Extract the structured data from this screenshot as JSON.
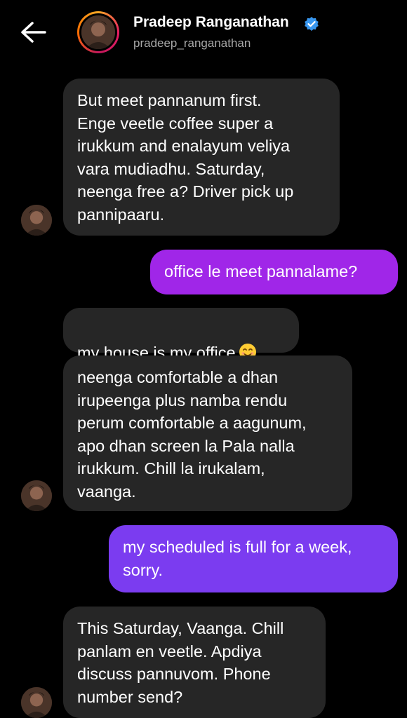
{
  "header": {
    "name": "Pradeep Ranganathan",
    "handle": "pradeep_ranganathan",
    "verified_color": "#3897f0",
    "back_icon": "back-arrow-icon"
  },
  "messages": [
    {
      "from": "them",
      "text": "But meet pannanum first.\nEnge veetle coffee super a\nirukkum and enalayum veliya\nvara mudiadhu. Saturday,\nneenga free a? Driver pick up\npannipaaru."
    },
    {
      "from": "me",
      "text": "office le meet pannalame?"
    },
    {
      "from": "them",
      "text": "my house is my office",
      "emoji": "smiling-face-emoji"
    },
    {
      "from": "them",
      "text": "neenga comfortable a dhan\nirupeenga plus namba rendu\nperum comfortable a aagunum,\napo dhan screen la Pala nalla\nirukkum. Chill la irukalam,\nvaanga."
    },
    {
      "from": "me",
      "text": "my scheduled is full for a week,\nsorry."
    },
    {
      "from": "them",
      "text": "This Saturday, Vaanga. Chill\npanlam en veetle. Apdiya\ndiscuss pannuvom. Phone\nnumber send?"
    }
  ],
  "colors": {
    "background": "#000000",
    "incoming_bubble": "#262626",
    "outgoing_bubble_1": "#a026e8",
    "outgoing_bubble_2": "#7b3cf0"
  }
}
